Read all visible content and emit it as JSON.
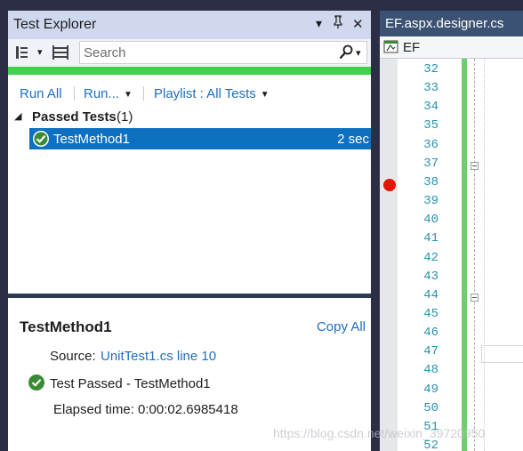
{
  "test_explorer": {
    "title": "Test Explorer",
    "title_buttons": {
      "dropdown": "▾",
      "pin": "📌",
      "close": "✕"
    },
    "toolbar": {
      "group_icon": "group-by-icon",
      "group_caret": "▾",
      "list_icon": "list-icon",
      "search_placeholder": "Search",
      "search_value": "",
      "search_icon": "magnifier-icon",
      "search_caret": "▾"
    },
    "progress": {
      "percent": 100,
      "color": "#3ed14a"
    },
    "actions": {
      "run_all": "Run All",
      "run": "Run...",
      "playlist": "Playlist : All Tests"
    },
    "group": {
      "name": "Passed Tests",
      "count": "(1)"
    },
    "tests": [
      {
        "name": "TestMethod1",
        "duration": "2 sec",
        "status": "passed"
      }
    ],
    "details": {
      "title": "TestMethod1",
      "copy_all": "Copy All",
      "source_label": "Source:",
      "source_link": "UnitTest1.cs line 10",
      "result": "Test Passed - TestMethod1",
      "elapsed": "Elapsed time: 0:00:02.6985418"
    }
  },
  "editor": {
    "tab": "EF.aspx.designer.cs",
    "nav": "EF",
    "line_numbers": [
      "32",
      "33",
      "34",
      "35",
      "36",
      "37",
      "38",
      "39",
      "40",
      "41",
      "42",
      "43",
      "44",
      "45",
      "46",
      "47",
      "48",
      "49",
      "50",
      "51",
      "52"
    ],
    "breakpoint_line": "38",
    "fold_lines": [
      "37",
      "44"
    ]
  },
  "watermark": "https://blog.csdn.net/weixin_39720950",
  "colors": {
    "accent": "#0e70c0",
    "link": "#1e6ec2",
    "pass": "#388a34",
    "breakpoint": "#e51400"
  }
}
